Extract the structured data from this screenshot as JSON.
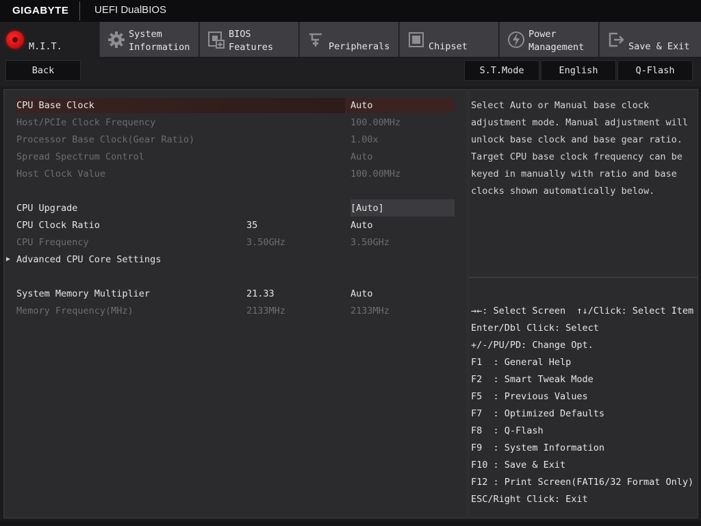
{
  "header": {
    "brand": "GIGABYTE",
    "product": "UEFI DualBIOS"
  },
  "tabs": [
    {
      "label": "M.I.T.",
      "icon": "mit-dial-icon",
      "active": true
    },
    {
      "label": "System\nInformation",
      "icon": "gear-icon"
    },
    {
      "label": "BIOS\nFeatures",
      "icon": "bios-chip-icon"
    },
    {
      "label": "Peripherals",
      "icon": "peripherals-icon"
    },
    {
      "label": "Chipset",
      "icon": "chipset-icon"
    },
    {
      "label": "Power\nManagement",
      "icon": "power-plug-icon"
    },
    {
      "label": "Save & Exit",
      "icon": "exit-door-icon"
    }
  ],
  "toolbar": {
    "back": "Back",
    "st_mode": "S.T.Mode",
    "language": "English",
    "qflash": "Q-Flash"
  },
  "settings": [
    {
      "label": "CPU Base Clock",
      "value": "Auto",
      "state": "selected"
    },
    {
      "label": "Host/PCIe Clock Frequency",
      "value": "100.00MHz",
      "state": "dim"
    },
    {
      "label": "Processor Base Clock(Gear Ratio)",
      "value": "1.00x",
      "state": "dim"
    },
    {
      "label": "Spread Spectrum Control",
      "value": "Auto",
      "state": "dim"
    },
    {
      "label": "Host Clock Value",
      "value": "100.00MHz",
      "state": "dim"
    },
    {
      "label": "CPU Upgrade",
      "value": "[Auto]",
      "state": "normal"
    },
    {
      "label": "CPU Clock Ratio",
      "current": "35",
      "value": "Auto",
      "state": "normal"
    },
    {
      "label": "CPU Frequency",
      "current": "3.50GHz",
      "value": "3.50GHz",
      "state": "dim"
    },
    {
      "label": "Advanced CPU Core Settings",
      "state": "submenu"
    },
    {
      "label": "System Memory Multiplier",
      "current": "21.33",
      "value": "Auto",
      "state": "normal"
    },
    {
      "label": "Memory Frequency(MHz)",
      "current": "2133MHz",
      "value": "2133MHz",
      "state": "dim"
    }
  ],
  "help": {
    "text": "Select Auto or Manual base clock adjustment mode. Manual adjustment will unlock base clock and base gear ratio. Target CPU base clock frequency can be keyed in manually with ratio and base clocks shown automatically below."
  },
  "keys": [
    "→←: Select Screen  ↑↓/Click: Select Item",
    "Enter/Dbl Click: Select",
    "+/-/PU/PD: Change Opt.",
    "F1  : General Help",
    "F2  : Smart Tweak Mode",
    "F5  : Previous Values",
    "F7  : Optimized Defaults",
    "F8  : Q-Flash",
    "F9  : System Information",
    "F10 : Save & Exit",
    "F12 : Print Screen(FAT16/32 Format Only)",
    "ESC/Right Click: Exit"
  ]
}
